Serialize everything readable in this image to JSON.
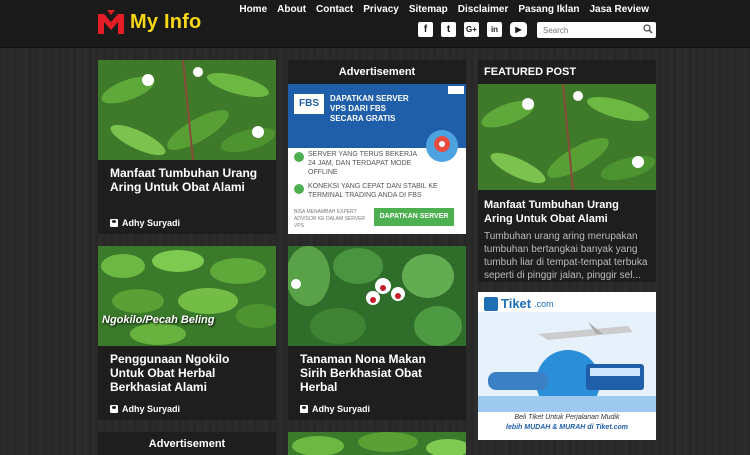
{
  "header": {
    "logo_text": "My Info",
    "nav": [
      "Home",
      "About",
      "Contact",
      "Privacy",
      "Sitemap",
      "Disclaimer",
      "Pasang Iklan",
      "Jasa Review"
    ],
    "social": [
      {
        "name": "facebook-icon",
        "glyph": "f"
      },
      {
        "name": "twitter-icon",
        "glyph": "t"
      },
      {
        "name": "google-plus-icon",
        "glyph": "G+"
      },
      {
        "name": "linkedin-icon",
        "glyph": "in"
      },
      {
        "name": "youtube-icon",
        "glyph": "▶"
      }
    ],
    "search_placeholder": "Search"
  },
  "posts": [
    {
      "title": "Manfaat Tumbuhan Urang Aring Untuk Obat Alami",
      "author": "Adhy Suryadi"
    },
    {
      "title": "Penggunaan Ngokilo Untuk Obat Herbal Berkhasiat Alami",
      "author": "Adhy Suryadi",
      "image_caption": "Ngokilo/Pecah Beling"
    },
    {
      "title": "Tanaman Nona Makan Sirih Berkhasiat Obat Herbal",
      "author": "Adhy Suryadi"
    }
  ],
  "ad": {
    "label": "Advertisement",
    "bottom_label": "Advertisement",
    "logo": "FBS",
    "headline": "DAPATKAN SERVER VPS DARI FBS SECARA GRATIS",
    "point1": "SERVER YANG TERUS BEKERJA 24 JAM, DAN TERDAPAT MODE OFFLINE",
    "point2": "KONEKSI YANG CEPAT DAN STABIL KE TERMINAL TRADING ANDA DI FBS",
    "small": "BISA MENAMBAH EXPERT ADVISOR KE DALAM SERVER VPS",
    "button": "DAPATKAN SERVER"
  },
  "featured": {
    "label": "FEATURED POST",
    "title": "Manfaat Tumbuhan Urang Aring Untuk Obat Alami",
    "excerpt": "Tumbuhan urang aring merupakan tumbuhan bertangkai banyak yang tumbuh liar di tempat-tempat terbuka seperti di pinggir jalan, pinggir sel..."
  },
  "tiket_ad": {
    "brand": "Tiket",
    "brand_suffix": ".com",
    "line1": "Beli Tiket Untuk Perjalanan Mudik",
    "line2": "lebih MUDAH & MURAH di Tiket.com"
  },
  "colors": {
    "logo": "#f7d716",
    "ad_blue": "#1f5fa9",
    "ad_green": "#4caf50"
  }
}
